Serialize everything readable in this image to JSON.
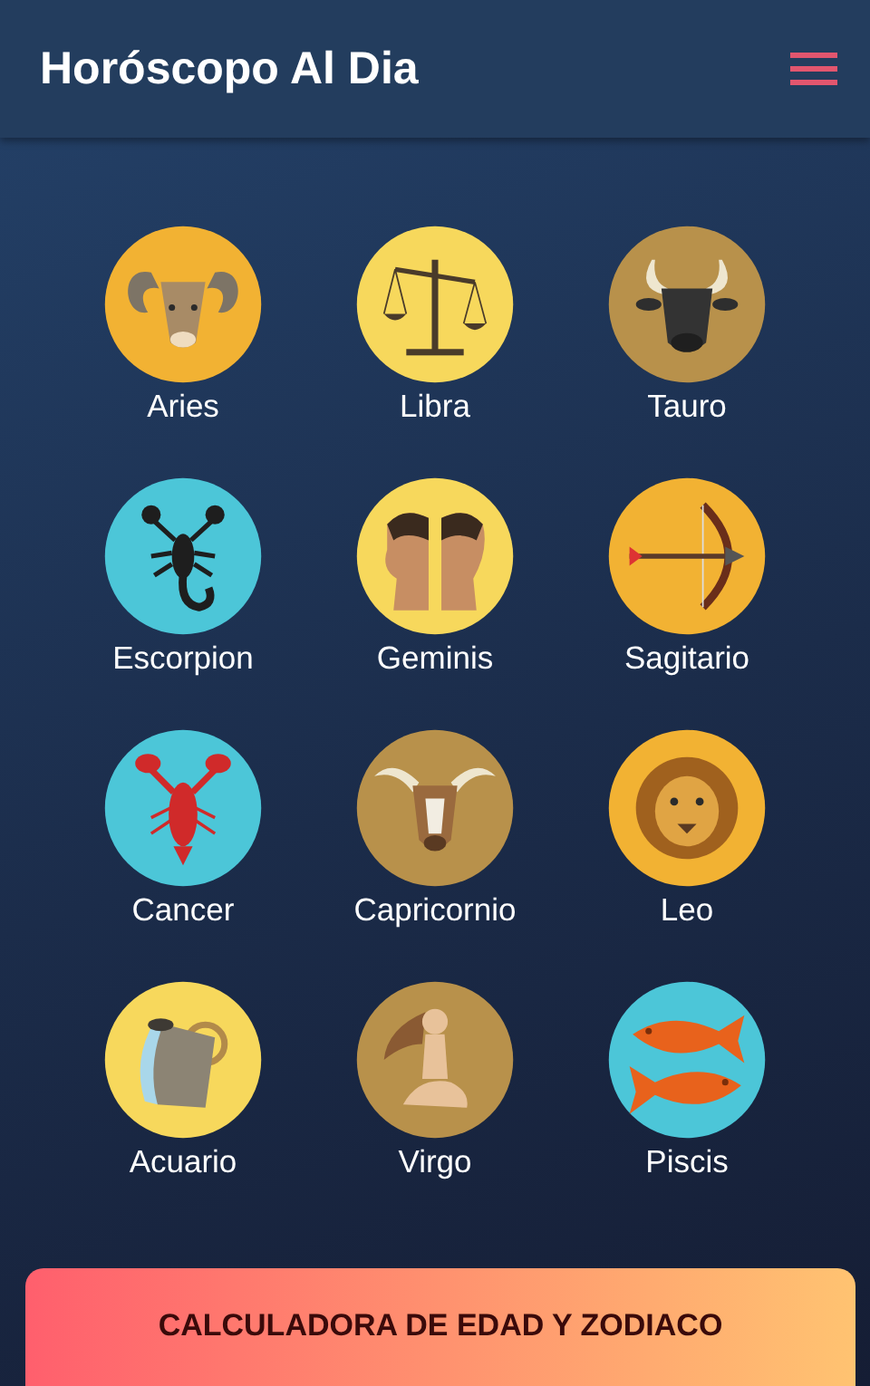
{
  "app_bar": {
    "title": "Horóscopo Al Dia"
  },
  "signs": [
    {
      "name": "Aries",
      "kind": "ram",
      "color": "#f2b233"
    },
    {
      "name": "Libra",
      "kind": "scales",
      "color": "#f7d85c"
    },
    {
      "name": "Tauro",
      "kind": "bull",
      "color": "#b8914b"
    },
    {
      "name": "Escorpion",
      "kind": "scorpion",
      "color": "#4cc6d8"
    },
    {
      "name": "Geminis",
      "kind": "twins",
      "color": "#f7d85c"
    },
    {
      "name": "Sagitario",
      "kind": "bow",
      "color": "#f2b233"
    },
    {
      "name": "Cancer",
      "kind": "lobster",
      "color": "#4cc6d8"
    },
    {
      "name": "Capricornio",
      "kind": "goat",
      "color": "#b8914b"
    },
    {
      "name": "Leo",
      "kind": "lion",
      "color": "#f2b233"
    },
    {
      "name": "Acuario",
      "kind": "jug",
      "color": "#f7d85c"
    },
    {
      "name": "Virgo",
      "kind": "figure",
      "color": "#b8914b"
    },
    {
      "name": "Piscis",
      "kind": "fish",
      "color": "#4cc6d8"
    }
  ],
  "bottom_button": {
    "label": "CALCULADORA DE EDAD Y ZODIACO"
  }
}
